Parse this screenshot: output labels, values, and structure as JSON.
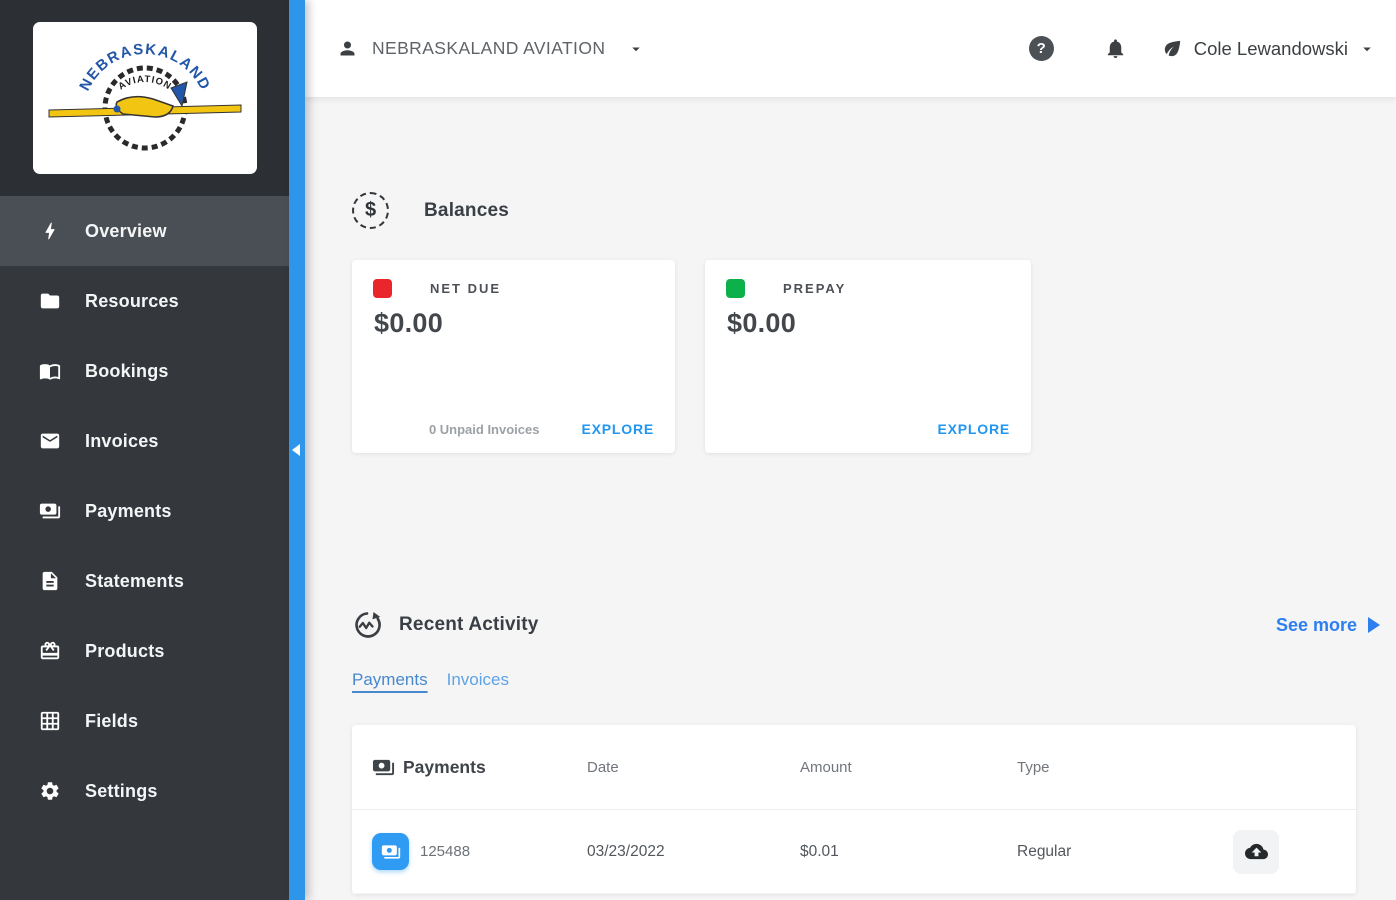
{
  "colors": {
    "accent_blue": "#2e96ea",
    "link_blue": "#2196f3",
    "net_due_red": "#e8262b",
    "prepay_green": "#0db14b",
    "sidebar_dark": "#34383d"
  },
  "logo": {
    "line1": "NEBRASKALAND",
    "line2": "AVIATION"
  },
  "sidebar": {
    "items": [
      {
        "label": "Overview",
        "icon": "bolt-icon",
        "active": true
      },
      {
        "label": "Resources",
        "icon": "folder-icon",
        "active": false
      },
      {
        "label": "Bookings",
        "icon": "book-icon",
        "active": false
      },
      {
        "label": "Invoices",
        "icon": "envelope-icon",
        "active": false
      },
      {
        "label": "Payments",
        "icon": "cash-icon",
        "active": false
      },
      {
        "label": "Statements",
        "icon": "document-icon",
        "active": false
      },
      {
        "label": "Products",
        "icon": "gift-icon",
        "active": false
      },
      {
        "label": "Fields",
        "icon": "grid-icon",
        "active": false
      },
      {
        "label": "Settings",
        "icon": "gear-icon",
        "active": false
      }
    ]
  },
  "topbar": {
    "org_name": "NEBRASKALAND AVIATION",
    "user_name": "Cole Lewandowski",
    "help_glyph": "?"
  },
  "balances": {
    "title": "Balances",
    "icon_glyph": "$",
    "cards": [
      {
        "label": "NET DUE",
        "amount": "$0.00",
        "footnote": "0 Unpaid Invoices",
        "action": "EXPLORE",
        "status_color": "#e8262b"
      },
      {
        "label": "PREPAY",
        "amount": "$0.00",
        "footnote": "",
        "action": "EXPLORE",
        "status_color": "#0db14b"
      }
    ]
  },
  "recent_activity": {
    "title": "Recent Activity",
    "see_more": "See more",
    "tabs": [
      {
        "label": "Payments",
        "active": true
      },
      {
        "label": "Invoices",
        "active": false
      }
    ],
    "table": {
      "title": "Payments",
      "columns": [
        "Date",
        "Amount",
        "Type"
      ],
      "rows": [
        {
          "id": "125488",
          "date": "03/23/2022",
          "amount": "$0.01",
          "type": "Regular"
        }
      ]
    }
  }
}
